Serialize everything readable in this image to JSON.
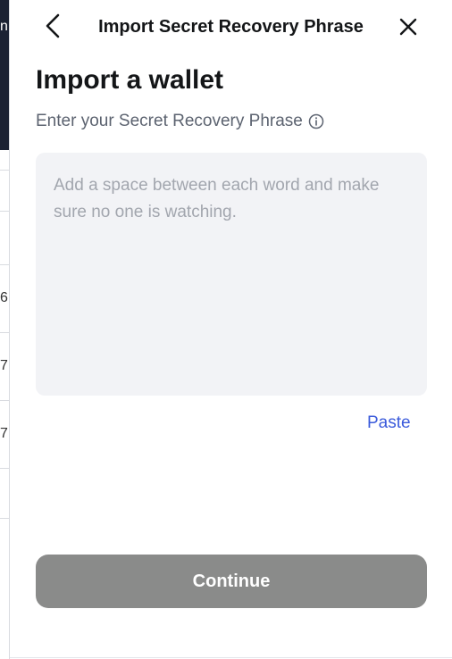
{
  "background": {
    "fragments": [
      "n",
      "6",
      "7",
      "7"
    ]
  },
  "header": {
    "title": "Import Secret Recovery Phrase",
    "back_icon": "chevron-left-icon",
    "close_icon": "close-icon"
  },
  "main": {
    "title": "Import a wallet",
    "field_label": "Enter your Secret Recovery Phrase",
    "info_icon": "info-icon",
    "phrase_value": "",
    "phrase_placeholder": "Add a space between each word and make sure no one is watching.",
    "paste_label": "Paste",
    "continue_label": "Continue"
  },
  "colors": {
    "accent": "#3b5bdb",
    "button_disabled": "#8a8b8a",
    "input_bg": "#f2f3f6",
    "title": "#141618",
    "muted": "#5c6370",
    "placeholder": "#a2a6ae"
  }
}
